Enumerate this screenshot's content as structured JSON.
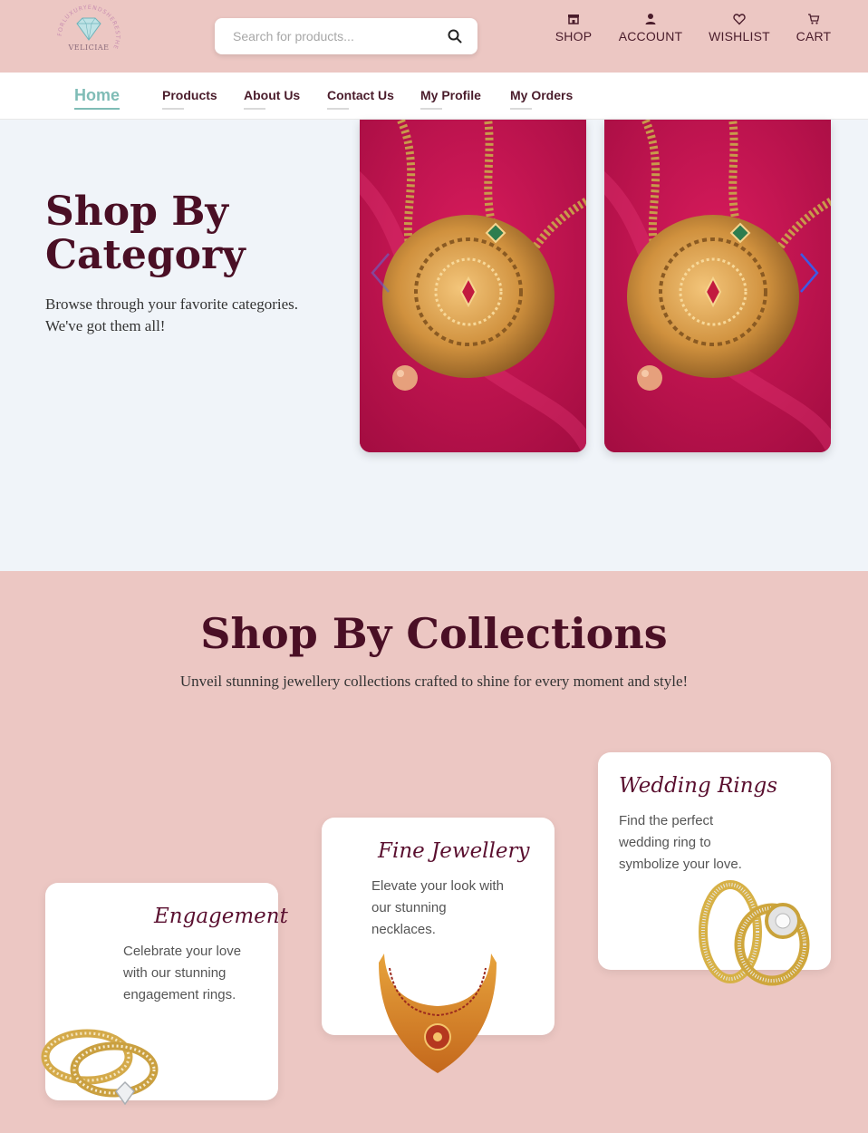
{
  "brand": {
    "logo_ring_text": "FORLUXURYENDSHERESTHE",
    "logo_name": "VELICIAE"
  },
  "search": {
    "placeholder": "Search for products..."
  },
  "top_nav": [
    {
      "label": "SHOP",
      "icon": "shop-icon"
    },
    {
      "label": "ACCOUNT",
      "icon": "user-icon"
    },
    {
      "label": "WISHLIST",
      "icon": "heart-icon"
    },
    {
      "label": "CART",
      "icon": "cart-icon"
    }
  ],
  "main_nav": {
    "home": "Home",
    "products": "Products",
    "about": "About Us",
    "contact": "Contact Us",
    "profile": "My Profile",
    "orders": "My Orders"
  },
  "category": {
    "title": "Shop By Category",
    "description": "Browse through your favorite categories. We've got them all!"
  },
  "collections": {
    "title": "Shop By Collections",
    "subtitle": "Unveil stunning jewellery collections crafted to shine for every moment and style!",
    "cards": [
      {
        "title": "Engagement",
        "description": "Celebrate your love with our stunning engagement rings."
      },
      {
        "title": "Fine Jewellery",
        "description": "Elevate your look with our stunning necklaces."
      },
      {
        "title": "Wedding Rings",
        "description": "Find the perfect wedding ring to symbolize your love."
      }
    ]
  },
  "colors": {
    "header_bg": "#ecc7c3",
    "accent_teal": "#7fbcb6",
    "brand_maroon": "#4a0f25",
    "category_bg": "#f0f4f9"
  }
}
